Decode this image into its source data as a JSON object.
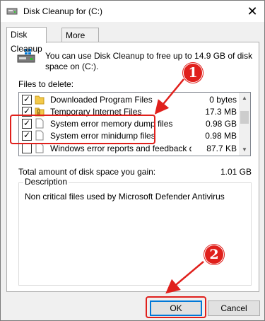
{
  "window": {
    "title": "Disk Cleanup for  (C:)"
  },
  "tabs": [
    {
      "label": "Disk Cleanup",
      "active": true
    },
    {
      "label": "More Options",
      "active": false
    }
  ],
  "intro_text": "You can use Disk Cleanup to free up to 14.9 GB of disk space on  (C:).",
  "files_label": "Files to delete:",
  "files": [
    {
      "name": "Downloaded Program Files",
      "size": "0 bytes",
      "checked": true,
      "icon": "folder-icon"
    },
    {
      "name": "Temporary Internet Files",
      "size": "17.3 MB",
      "checked": true,
      "icon": "lock-folder-icon"
    },
    {
      "name": "System error memory dump files",
      "size": "0.98 GB",
      "checked": true,
      "icon": "file-icon"
    },
    {
      "name": "System error minidump files",
      "size": "0.98 MB",
      "checked": true,
      "icon": "file-icon"
    },
    {
      "name": "Windows error reports and feedback di...",
      "size": "87.7 KB",
      "checked": false,
      "icon": "file-icon"
    }
  ],
  "total_label": "Total amount of disk space you gain:",
  "total_value": "1.01 GB",
  "description": {
    "title": "Description",
    "text": "Non critical files used by Microsoft Defender Antivirus"
  },
  "buttons": {
    "ok": "OK",
    "cancel": "Cancel"
  },
  "annotations": {
    "badge1": "1",
    "badge2": "2",
    "color": "#e0201c"
  }
}
